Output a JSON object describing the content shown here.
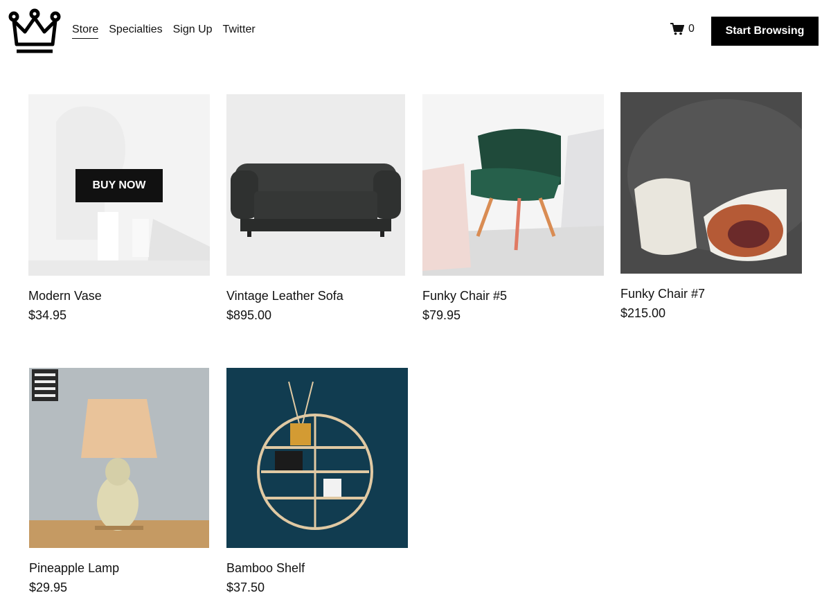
{
  "header": {
    "logo_icon": "crown-icon",
    "nav": [
      {
        "label": "Store",
        "active": true
      },
      {
        "label": "Specialties"
      },
      {
        "label": "Sign Up"
      },
      {
        "label": "Twitter"
      }
    ],
    "cart": {
      "icon": "cart-icon",
      "count": "0"
    },
    "cta_label": "Start Browsing"
  },
  "products": [
    {
      "name": "Modern Vase",
      "price": "$34.95",
      "overlay_label": "BUY NOW"
    },
    {
      "name": "Vintage Leather Sofa",
      "price": "$895.00"
    },
    {
      "name": "Funky Chair #5",
      "price": "$79.95"
    },
    {
      "name": "Funky Chair #7",
      "price": "$215.00"
    },
    {
      "name": "Pineapple Lamp",
      "price": "$29.95"
    },
    {
      "name": "Bamboo Shelf",
      "price": "$37.50"
    }
  ],
  "colors": {
    "button_bg": "#000000",
    "button_text": "#ffffff",
    "text": "#111111"
  }
}
